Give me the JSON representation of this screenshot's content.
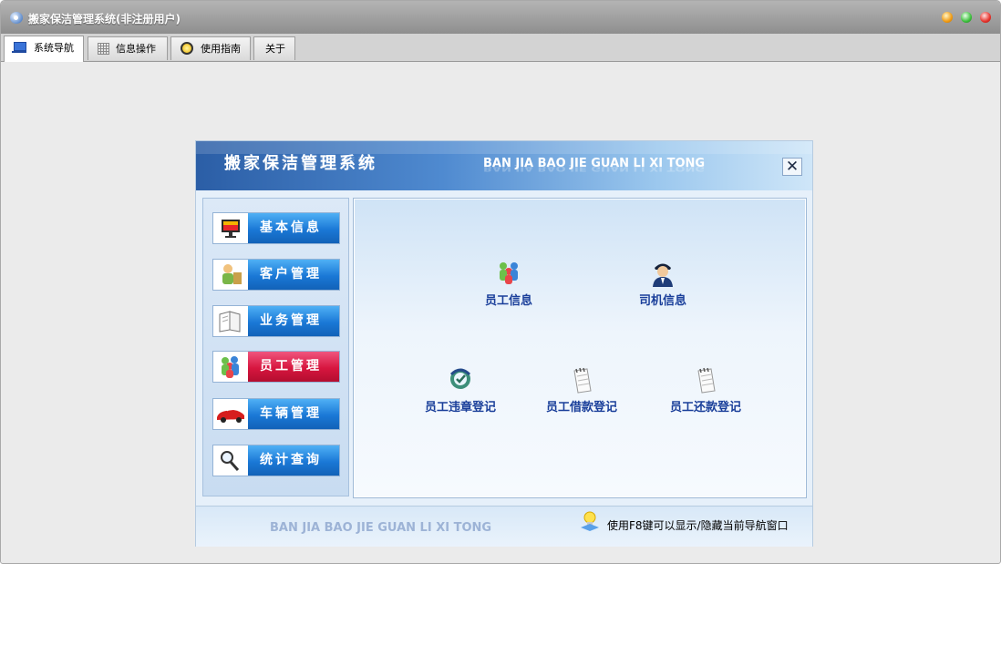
{
  "window": {
    "title": "搬家保洁管理系统(非注册用户)"
  },
  "tabs": [
    {
      "label": "系统导航",
      "icon": "monitor-icon",
      "active": true
    },
    {
      "label": "信息操作",
      "icon": "grid-icon",
      "active": false
    },
    {
      "label": "使用指南",
      "icon": "guide-icon",
      "active": false
    },
    {
      "label": "关于",
      "icon": "",
      "active": false
    }
  ],
  "nav": {
    "title": "搬家保洁管理系统",
    "pinyin": "BAN JIA BAO JIE GUAN LI XI TONG",
    "close_label": "✕",
    "sidebar": [
      {
        "label": "基本信息",
        "icon": "monitor-icon",
        "active": false
      },
      {
        "label": "客户管理",
        "icon": "customer-icon",
        "active": false
      },
      {
        "label": "业务管理",
        "icon": "book-icon",
        "active": false
      },
      {
        "label": "员工管理",
        "icon": "staff-icon",
        "active": true
      },
      {
        "label": "车辆管理",
        "icon": "car-icon",
        "active": false
      },
      {
        "label": "统计查询",
        "icon": "magnifier-icon",
        "active": false
      }
    ],
    "items": [
      {
        "label": "员工信息",
        "icon": "staff-group-icon"
      },
      {
        "label": "司机信息",
        "icon": "driver-icon"
      },
      {
        "label": "员工违章登记",
        "icon": "violation-icon"
      },
      {
        "label": "员工借款登记",
        "icon": "notepad-icon"
      },
      {
        "label": "员工还款登记",
        "icon": "notepad-icon"
      }
    ],
    "footer": {
      "pinyin": "BAN JIA BAO JIE GUAN LI XI TONG",
      "tip": "使用F8键可以显示/隐藏当前导航窗口"
    }
  },
  "colors": {
    "sidebar_button": "#1a78d6",
    "sidebar_button_active": "#d7163f",
    "item_text": "#1a3f9a",
    "header_dark": "#2b5ea6"
  }
}
